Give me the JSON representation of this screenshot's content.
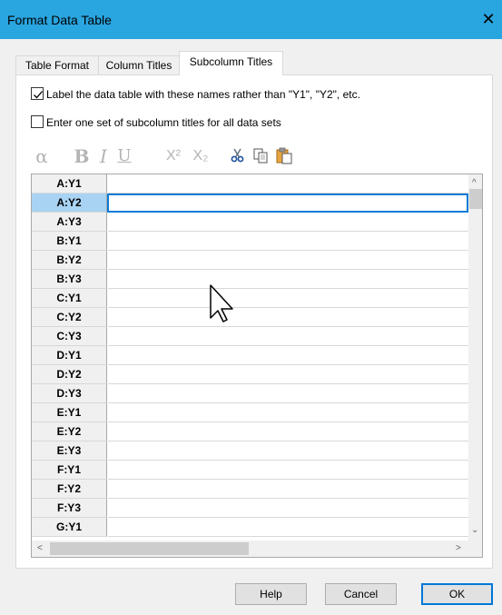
{
  "window": {
    "title": "Format Data Table",
    "close_glyph": "✕"
  },
  "tabs": [
    {
      "label": "Table Format"
    },
    {
      "label": "Column Titles"
    },
    {
      "label": "Subcolumn Titles",
      "active": true
    }
  ],
  "options": {
    "label_names": {
      "label": "Label the data table with these names rather than \"Y1\", \"Y2\", etc.",
      "checked": true
    },
    "one_set": {
      "label": "Enter one set of subcolumn titles for all data sets",
      "checked": false
    }
  },
  "toolbar": {
    "alpha": "α",
    "bold": "B",
    "italic": "I",
    "underline": "U",
    "superscript": "X²",
    "subscript": "X₂",
    "icons": [
      "cut-icon",
      "copy-icon",
      "paste-icon"
    ]
  },
  "table": {
    "rows": [
      "A:Y1",
      "A:Y2",
      "A:Y3",
      "B:Y1",
      "B:Y2",
      "B:Y3",
      "C:Y1",
      "C:Y2",
      "C:Y3",
      "D:Y1",
      "D:Y2",
      "D:Y3",
      "E:Y1",
      "E:Y2",
      "E:Y3",
      "F:Y1",
      "F:Y2",
      "F:Y3",
      "G:Y1"
    ],
    "selected_index": 1,
    "selected_color": "#a9d3f3"
  },
  "scroll": {
    "up": "^",
    "down": "⌄",
    "left": "<",
    "right": ">"
  },
  "buttons": {
    "help": "Help",
    "cancel": "Cancel",
    "ok": "OK"
  },
  "colors": {
    "titlebar": "#29a5e0",
    "accent": "#0078d7"
  }
}
